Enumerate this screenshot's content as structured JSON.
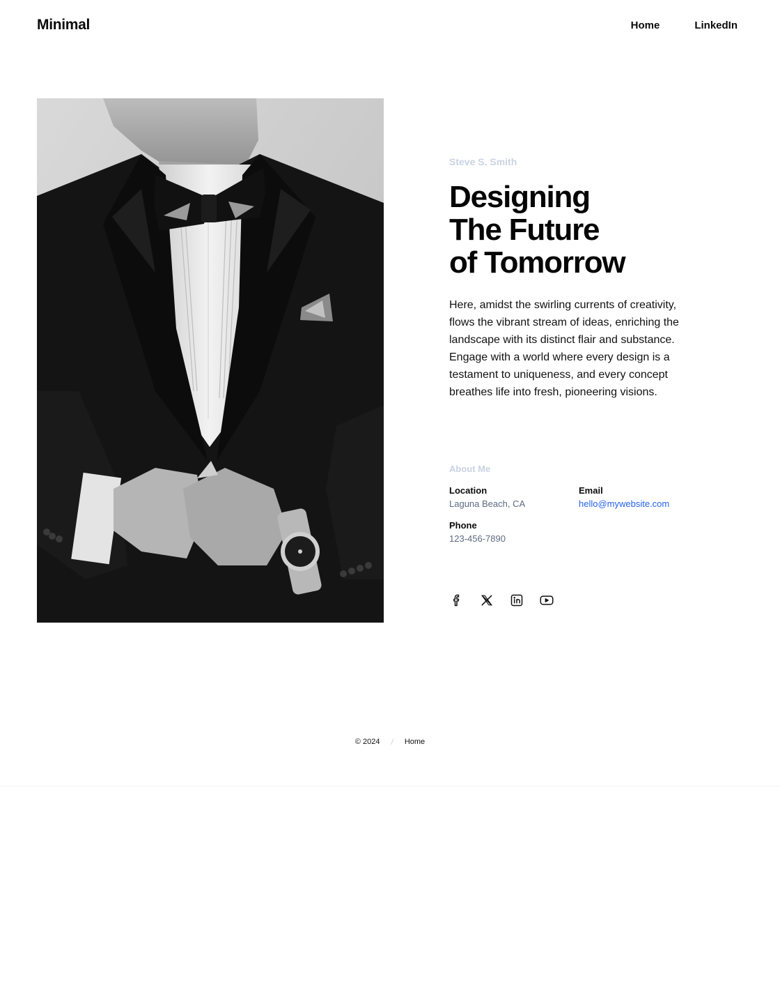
{
  "header": {
    "brand": "Minimal",
    "nav": [
      {
        "label": "Home"
      },
      {
        "label": "LinkedIn"
      }
    ]
  },
  "hero": {
    "name": "Steve S. Smith",
    "headline": [
      "Designing",
      "The Future",
      "of Tomorrow"
    ],
    "intro": "Here, amidst the swirling currents of creativity, flows the vibrant stream of ideas, enriching the landscape with its distinct flair and substance. Engage with a world where every design is a testament to uniqueness, and every concept breathes life into fresh, pioneering visions."
  },
  "about": {
    "title": "About Me",
    "location": {
      "label": "Location",
      "value": "Laguna Beach, CA"
    },
    "email": {
      "label": "Email",
      "value": "hello@mywebsite.com"
    },
    "phone": {
      "label": "Phone",
      "value": "123-456-7890"
    }
  },
  "socials": [
    {
      "icon": "facebook-icon"
    },
    {
      "icon": "x-icon"
    },
    {
      "icon": "linkedin-icon"
    },
    {
      "icon": "youtube-icon"
    }
  ],
  "footer": {
    "copyright": "© 2024",
    "separator": "/",
    "link": "Home"
  },
  "colors": {
    "accent": "#2563eb",
    "muted": "#c9d3e3",
    "value": "#5d6b82"
  }
}
